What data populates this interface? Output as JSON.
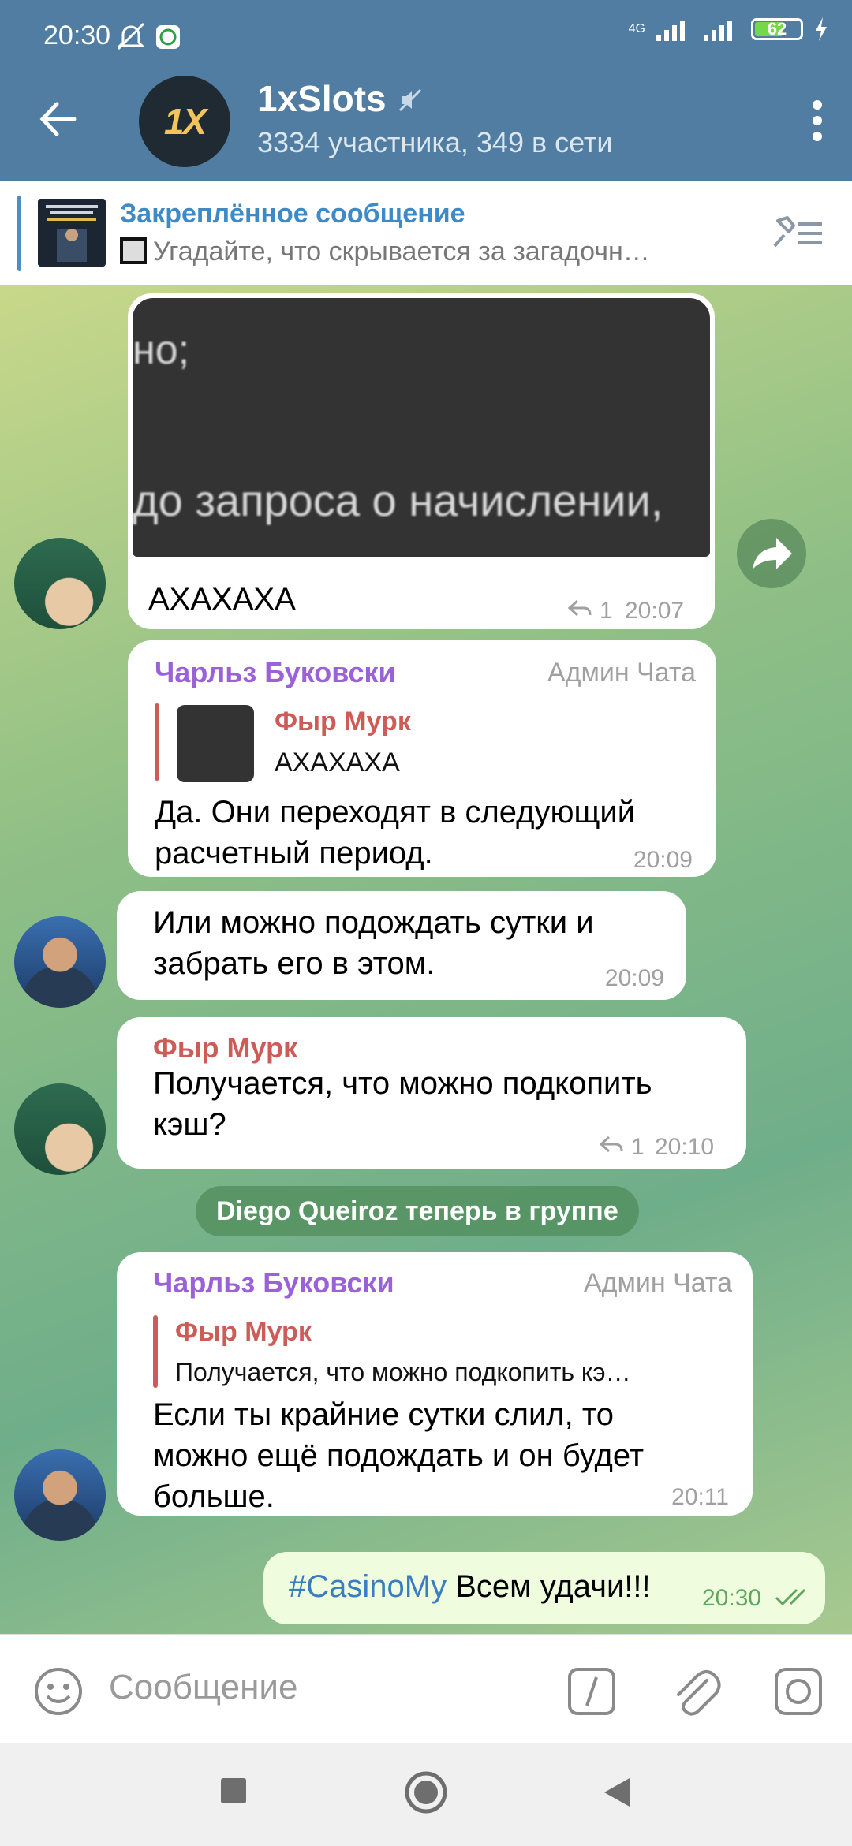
{
  "status_bar": {
    "time": "20:30",
    "network": "4G",
    "battery": "62",
    "battery_level": 0.62
  },
  "header": {
    "title": "1xSlots",
    "subtitle": "3334 участника, 349 в сети",
    "avatar_text": "1X"
  },
  "pinned": {
    "title": "Закреплённое сообщение",
    "text": "Угадайте, что скрывается за загадочн…"
  },
  "messages": [
    {
      "id": "m1",
      "image_text_top": "но;",
      "image_text_bottom": "до запроса о начислении,",
      "text": "АХАХАХА",
      "replies": "1",
      "time": "20:07"
    },
    {
      "id": "m2",
      "sender": "Чарльз Буковски",
      "role": "Админ Чата",
      "reply_to_name": "Фыр Мурк",
      "reply_to_text": "АХАХАХА",
      "text_line1": "Да. Они переходят в следующий",
      "text_line2": "расчетный период.",
      "time": "20:09"
    },
    {
      "id": "m3",
      "text_line1": "Или можно подождать сутки и",
      "text_line2": "забрать его в этом.",
      "time": "20:09"
    },
    {
      "id": "m4",
      "sender": "Фыр Мурк",
      "text_line1": "Получается, что можно подкопить",
      "text_line2": "кэш?",
      "replies": "1",
      "time": "20:10"
    },
    {
      "id": "service",
      "text": "Diego Queiroz теперь в группе"
    },
    {
      "id": "m5",
      "sender": "Чарльз Буковски",
      "role": "Админ Чата",
      "reply_to_name": "Фыр Мурк",
      "reply_to_text": "Получается, что можно подкопить кэ…",
      "text_line1": "Если ты крайние сутки слил, то",
      "text_line2": "можно ещё подождать и он будет",
      "text_line3": "больше.",
      "time": "20:11"
    },
    {
      "id": "m6",
      "hashtag": "#CasinoMy",
      "text": "Всем удачи!!!",
      "time": "20:30"
    }
  ],
  "input": {
    "placeholder": "Сообщение"
  },
  "colors": {
    "header": "#517da2",
    "accent": "#3f8ac4",
    "admin_name": "#9b62d8",
    "reply_name": "#cc5c58",
    "outgoing_bubble": "#effdde"
  }
}
